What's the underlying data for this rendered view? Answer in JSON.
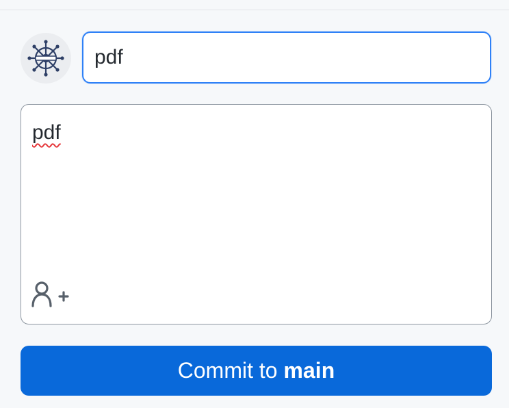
{
  "commit_panel": {
    "summary": {
      "value": "pdf"
    },
    "description": {
      "value": "pdf",
      "spellcheck_error": true
    },
    "coauthor_icon": "add-person-icon",
    "avatar_icon": "ship-wheel-icon",
    "commit_button": {
      "prefix": "Commit to",
      "branch": "main"
    }
  },
  "colors": {
    "accent": "#0969da",
    "focus_border": "#2f81f7",
    "panel_background": "#f6f8fa",
    "spellcheck_underline": "#e5383b"
  }
}
